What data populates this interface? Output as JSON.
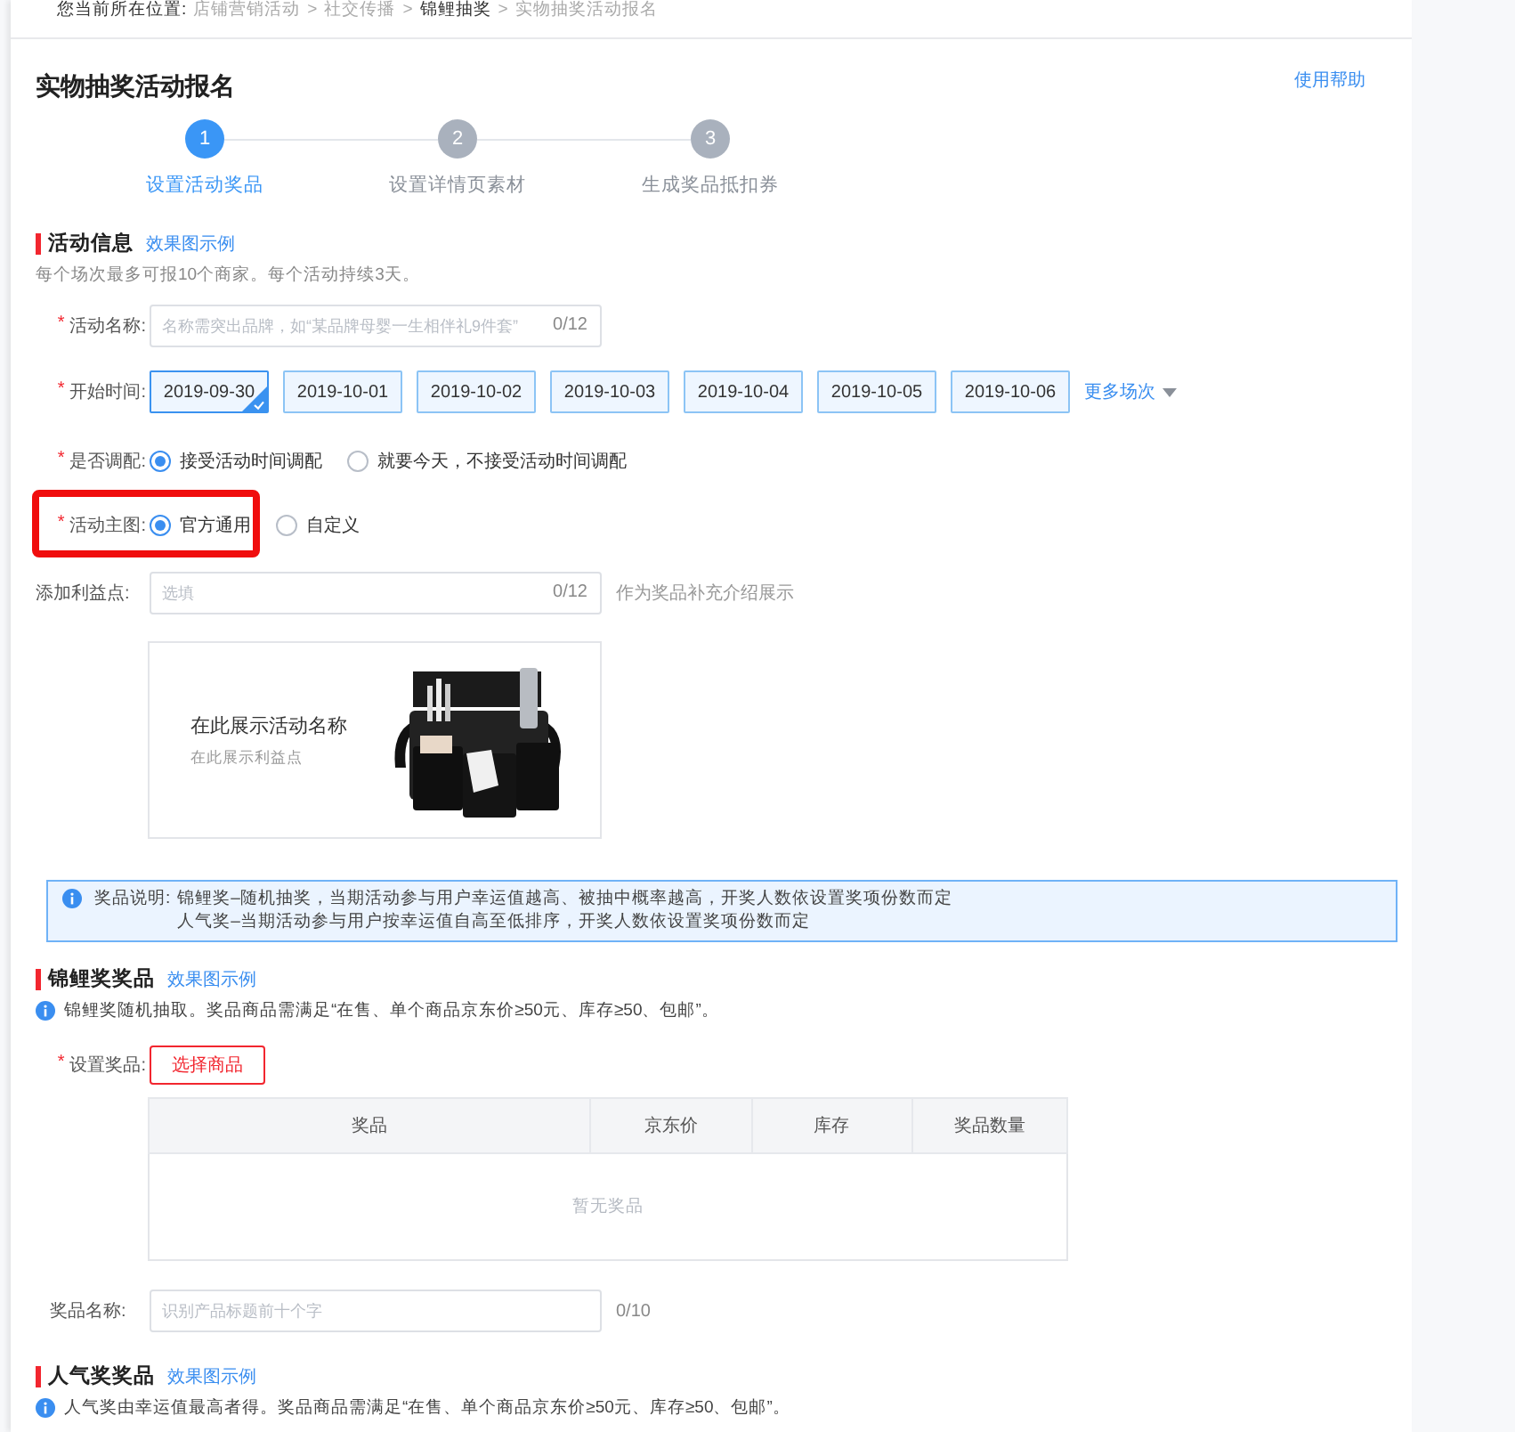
{
  "breadcrumb": {
    "prefix": "您当前所在位置:",
    "separator": ">",
    "items": [
      {
        "label": "店铺营销活动",
        "current": false
      },
      {
        "label": "社交传播",
        "current": false
      },
      {
        "label": "锦鲤抽奖",
        "current": true
      },
      {
        "label": "实物抽奖活动报名",
        "current": false
      }
    ]
  },
  "page_title": "实物抽奖活动报名",
  "help_link": "使用帮助",
  "required_mark": "*",
  "steps": [
    {
      "number": "1",
      "label": "设置活动奖品",
      "selected": true
    },
    {
      "number": "2",
      "label": "设置详情页素材",
      "selected": false
    },
    {
      "number": "3",
      "label": "生成奖品抵扣券",
      "selected": false
    }
  ],
  "activity_section": {
    "title": "活动信息",
    "example_link": "效果图示例",
    "note": "每个场次最多可报10个商家。每个活动持续3天。",
    "fields": [
      {
        "kind": "text",
        "label": "活动名称:",
        "required": true,
        "placeholder": "名称需突出品牌，如“某品牌母婴一生相伴礼9件套”",
        "counter": "0/12"
      },
      {
        "kind": "dates",
        "label": "开始时间:",
        "required": true,
        "dates": [
          {
            "label": "2019-09-30",
            "selected": true
          },
          {
            "label": "2019-10-01",
            "selected": false
          },
          {
            "label": "2019-10-02",
            "selected": false
          },
          {
            "label": "2019-10-03",
            "selected": false
          },
          {
            "label": "2019-10-04",
            "selected": false
          },
          {
            "label": "2019-10-05",
            "selected": false
          },
          {
            "label": "2019-10-06",
            "selected": false
          }
        ],
        "more": "更多场次"
      },
      {
        "kind": "radio",
        "label": "是否调配:",
        "required": true,
        "options": [
          {
            "label": "接受活动时间调配",
            "selected": true
          },
          {
            "label": "就要今天，不接受活动时间调配",
            "selected": false
          }
        ]
      },
      {
        "kind": "radio",
        "label": "活动主图:",
        "required": true,
        "options": [
          {
            "label": "官方通用",
            "selected": true
          },
          {
            "label": "自定义",
            "selected": false
          }
        ],
        "highlighted": true
      },
      {
        "kind": "text",
        "label": "添加利益点:",
        "placeholder": "选填",
        "counter": "0/12",
        "hint": "作为奖品补充介绍展示"
      }
    ],
    "preview": {
      "title": "在此展示活动名称",
      "subtitle": "在此展示利益点"
    }
  },
  "prize_info": {
    "label": "奖品说明:",
    "lines": [
      "锦鲤奖–随机抽奖，当期活动参与用户幸运值越高、被抽中概率越高，开奖人数依设置奖项份数而定",
      "人气奖–当期活动参与用户按幸运值自高至低排序，开奖人数依设置奖项份数而定"
    ]
  },
  "koi_section": {
    "title": "锦鲤奖奖品",
    "example_link": "效果图示例",
    "note": "锦鲤奖随机抽取。奖品商品需满足“在售、单个商品京东价≥50元、库存≥50、包邮”。",
    "set_prize_label": "设置奖品:",
    "set_prize_required": true,
    "select_button": "选择商品",
    "table": {
      "columns": [
        "奖品",
        "京东价",
        "库存",
        "奖品数量"
      ],
      "empty": "暂无奖品"
    },
    "name_field": {
      "label": "奖品名称:",
      "placeholder": "识别产品标题前十个字",
      "counter": "0/10"
    }
  },
  "popular_section": {
    "title": "人气奖奖品",
    "example_link": "效果图示例",
    "note": "人气奖由幸运值最高者得。奖品商品需满足“在售、单个商品京东价≥50元、库存≥50、包邮”。"
  }
}
